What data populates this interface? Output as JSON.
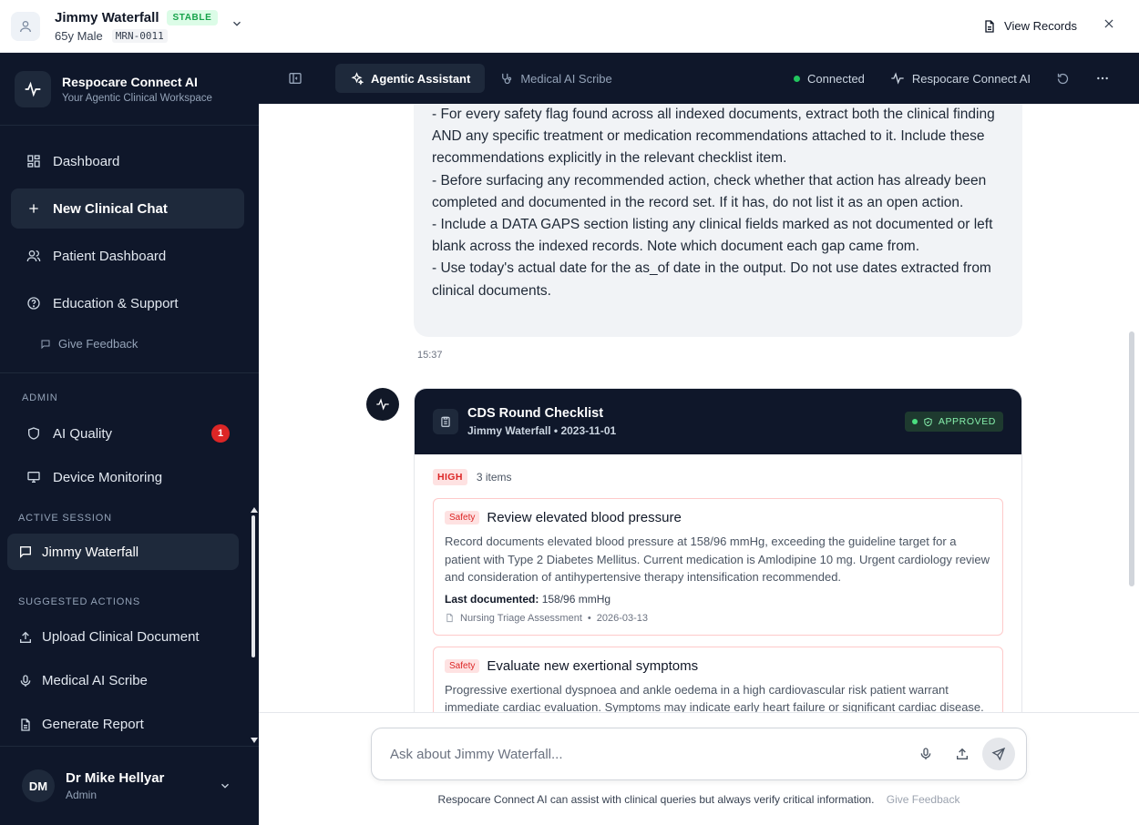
{
  "patient": {
    "name": "Jimmy Waterfall",
    "status": "STABLE",
    "demographics": "65y Male",
    "mrn": "MRN-0011"
  },
  "topbar": {
    "view_records": "View Records"
  },
  "brand": {
    "title": "Respocare Connect AI",
    "subtitle": "Your Agentic Clinical Workspace"
  },
  "nav": {
    "dashboard": "Dashboard",
    "new_chat": "New Clinical Chat",
    "patient_dashboard": "Patient Dashboard",
    "education": "Education & Support",
    "feedback": "Give Feedback"
  },
  "admin": {
    "label": "ADMIN",
    "ai_quality": "AI Quality",
    "ai_quality_count": "1",
    "device_monitoring": "Device Monitoring"
  },
  "session": {
    "label": "ACTIVE SESSION",
    "name": "Jimmy Waterfall"
  },
  "suggested": {
    "label": "SUGGESTED ACTIONS",
    "upload": "Upload Clinical Document",
    "scribe": "Medical AI Scribe",
    "report": "Generate Report"
  },
  "user": {
    "initials": "DM",
    "name": "Dr Mike Hellyar",
    "role": "Admin"
  },
  "toolbar": {
    "tab_assistant": "Agentic Assistant",
    "tab_scribe": "Medical AI Scribe",
    "connected": "Connected",
    "brand": "Respocare Connect AI"
  },
  "user_message": {
    "lines": [
      "- For every safety flag found across all indexed documents, extract both the clinical finding AND any specific treatment or medication recommendations attached to it. Include these recommendations explicitly in the relevant checklist item.",
      "- Before surfacing any recommended action, check whether that action has already been completed and documented in the record set. If it has, do not list it as an open action.",
      "- Include a DATA GAPS section listing any clinical fields marked as not documented or left blank across the indexed records. Note which document each gap came from.",
      "- Use today's actual date for the as_of date in the output. Do not use dates extracted from clinical documents."
    ],
    "time": "15:37"
  },
  "checklist": {
    "title": "CDS Round Checklist",
    "subtitle": "Jimmy Waterfall • 2023-11-01",
    "status": "APPROVED",
    "priority": "HIGH",
    "count": "3 items",
    "items": [
      {
        "tag": "Safety",
        "title": "Review elevated blood pressure",
        "description": "Record documents elevated blood pressure at 158/96 mmHg, exceeding the guideline target for a patient with Type 2 Diabetes Mellitus. Current medication is Amlodipine 10 mg. Urgent cardiology review and consideration of antihypertensive therapy intensification recommended.",
        "last_label": "Last documented:",
        "last_value": "158/96 mmHg",
        "source_doc": "Nursing Triage Assessment",
        "source_date": "2026-03-13"
      },
      {
        "tag": "Safety",
        "title": "Evaluate new exertional symptoms",
        "description": "Progressive exertional dyspnoea and ankle oedema in a high cardiovascular risk patient warrant immediate cardiac evaluation. Symptoms may indicate early heart failure or significant cardiac disease."
      }
    ]
  },
  "composer": {
    "placeholder": "Ask about Jimmy Waterfall...",
    "disclaimer": "Respocare Connect AI can assist with clinical queries but always verify critical information.",
    "feedback": "Give Feedback"
  }
}
